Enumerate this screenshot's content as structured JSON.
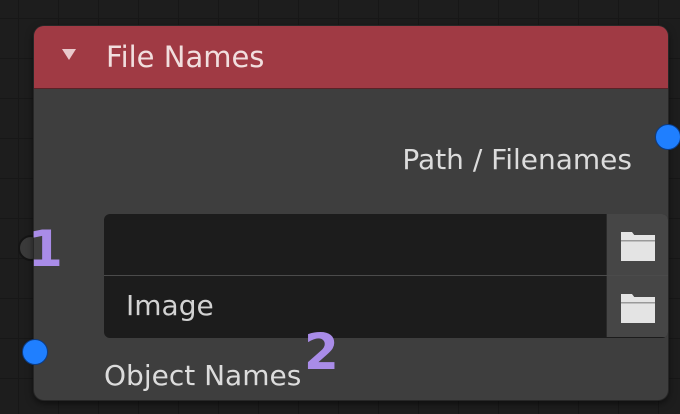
{
  "node": {
    "title": "File Names",
    "header_color": "#a03a44",
    "outputs": [
      {
        "label": "Path / Filenames",
        "socket_color": "#1f7fff"
      }
    ],
    "path_list": [
      {
        "value": "",
        "icon": "folder-icon"
      },
      {
        "value": "Image",
        "icon": "folder-icon"
      }
    ],
    "inputs": [
      {
        "label": "Object Names",
        "socket_color": "#1f7fff"
      }
    ]
  },
  "annotations": {
    "marker_1": "1",
    "marker_2": "2",
    "color": "#a98ce8"
  }
}
